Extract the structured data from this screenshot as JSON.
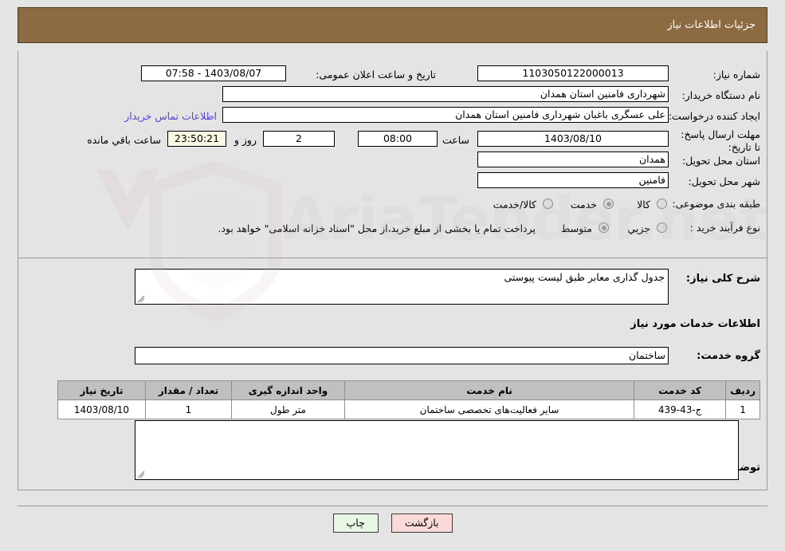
{
  "window": {
    "title": "جزئیات اطلاعات نیاز",
    "header_bg": "#8c6b42",
    "header_text_color": "#ffffff"
  },
  "watermark": {
    "text": "AriaTender.net"
  },
  "form": {
    "need_number": {
      "label": "شماره نیاز:",
      "value": "1103050122000013"
    },
    "public_announce": {
      "label": "تاریخ و ساعت اعلان عمومی:",
      "value": "1403/08/07 - 07:58"
    },
    "buyer_org": {
      "label": "نام دستگاه خریدار:",
      "value": "شهرداری فامنین استان همدان"
    },
    "request_creator": {
      "label": "ایجاد کننده درخواست:",
      "value": "علی عسگری باغبان شهرداری فامنین استان همدان"
    },
    "contact_link": {
      "label": "اطلاعات تماس خریدار"
    },
    "deadline": {
      "label": "مهلت ارسال پاسخ: تا تاریخ:",
      "date": "1403/08/10",
      "time_label": "ساعت",
      "time": "08:00",
      "days": "2",
      "days_suffix": "روز و",
      "countdown": "23:50:21",
      "countdown_suffix": "ساعت باقي مانده"
    },
    "delivery_province": {
      "label": "استان محل تحویل:",
      "value": "همدان"
    },
    "delivery_city": {
      "label": "شهر محل تحویل:",
      "value": "فامنین"
    },
    "subject_class": {
      "label": "طبقه بندی موضوعی:",
      "options": [
        {
          "label": "کالا",
          "selected": false
        },
        {
          "label": "خدمت",
          "selected": true
        },
        {
          "label": "کالا/خدمت",
          "selected": false
        }
      ]
    },
    "purchase_process": {
      "label": "نوع فرآیند خرید :",
      "options": [
        {
          "label": "جزيي",
          "selected": false
        },
        {
          "label": "متوسط",
          "selected": true
        }
      ],
      "note": "پرداخت تمام یا بخشی از مبلغ خرید،از محل \"اسناد خزانه اسلامی\" خواهد بود."
    },
    "general_description": {
      "label": "شرح کلی نیاز:",
      "value": "جدول گذاری معابر طبق لیست پیوستی"
    },
    "services_section_title": "اطلاعات خدمات مورد نیاز",
    "service_group": {
      "label": "گروه خدمت:",
      "value": "ساختمان"
    },
    "buyer_notes": {
      "label": "توضیحات خریدار:",
      "value": ""
    }
  },
  "items_table": {
    "columns": [
      "ردیف",
      "کد خدمت",
      "نام خدمت",
      "واحد اندازه گیری",
      "تعداد / مقدار",
      "تاریخ نیاز"
    ],
    "rows": [
      {
        "row": "1",
        "service_code": "ج-43-439",
        "service_name": "سایر فعالیت‌های تخصصی ساختمان",
        "unit": "متر طول",
        "quantity": "1",
        "need_date": "1403/08/10"
      }
    ]
  },
  "buttons": {
    "print": "چاپ",
    "back": "بازگشت"
  }
}
